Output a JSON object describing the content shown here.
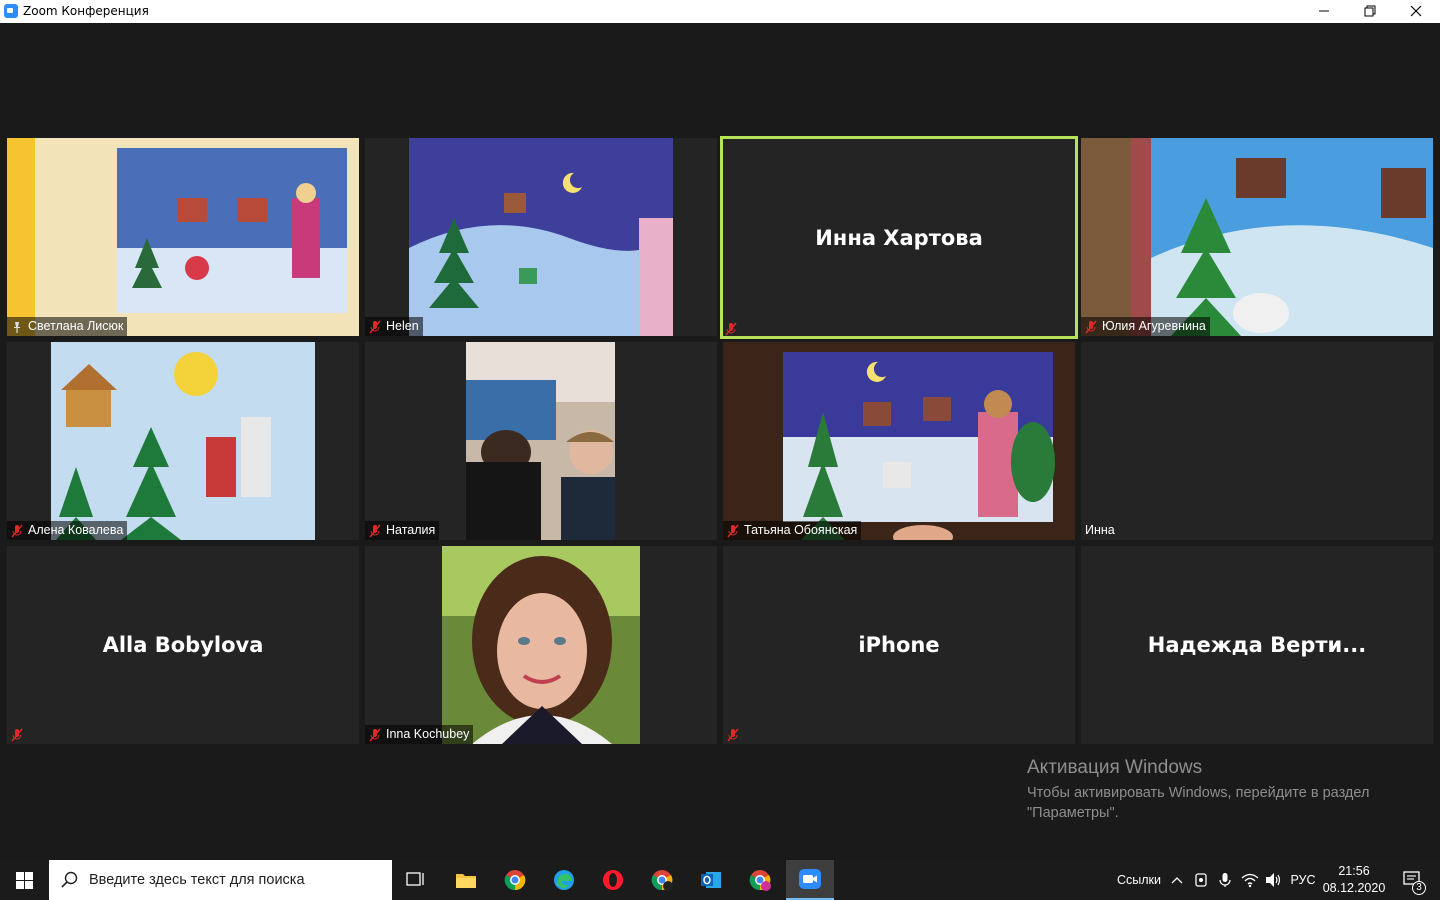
{
  "window": {
    "title": "Zoom Конференция",
    "minimize_icon": "minimize-icon",
    "maximize_icon": "restore-icon",
    "close_icon": "close-icon"
  },
  "participants": [
    {
      "name": "Светлана Лисюк",
      "video": true,
      "mic": "pin",
      "active": false
    },
    {
      "name": "Helen",
      "video": true,
      "mic": "muted",
      "active": false
    },
    {
      "name": "Инна Хартова",
      "video": false,
      "mic": "muted",
      "active": true
    },
    {
      "name": "Юлия Агуревнина",
      "video": true,
      "mic": "muted",
      "active": false
    },
    {
      "name": "Алена Ковалева",
      "video": true,
      "mic": "muted",
      "active": false
    },
    {
      "name": "Наталия",
      "video": true,
      "mic": "muted",
      "active": false
    },
    {
      "name": "Татьяна Обоянская",
      "video": true,
      "mic": "muted",
      "active": false
    },
    {
      "name": "Инна",
      "video": false,
      "mic": "none",
      "active": false
    },
    {
      "name": "Alla Bobylova",
      "video": false,
      "mic": "muted",
      "active": false
    },
    {
      "name": "Inna Kochubey",
      "video": true,
      "mic": "muted",
      "active": false
    },
    {
      "name": "iPhone",
      "video": false,
      "mic": "muted",
      "active": false
    },
    {
      "name": "Надежда  Верти...",
      "video": false,
      "mic": "none",
      "active": false
    }
  ],
  "watermark": {
    "heading": "Активация Windows",
    "line1": "Чтобы активировать Windows, перейдите в раздел",
    "line2": "\"Параметры\"."
  },
  "taskbar": {
    "search_placeholder": "Введите здесь текст для поиска",
    "links_label": "Ссылки",
    "language": "РУС",
    "time": "21:56",
    "date": "08.12.2020",
    "notifications_count": "3",
    "apps": [
      "task-view-icon",
      "file-explorer-icon",
      "chrome-icon",
      "edge-icon",
      "opera-icon",
      "chrome-icon",
      "outlook-icon",
      "chrome-icon",
      "zoom-icon"
    ]
  }
}
